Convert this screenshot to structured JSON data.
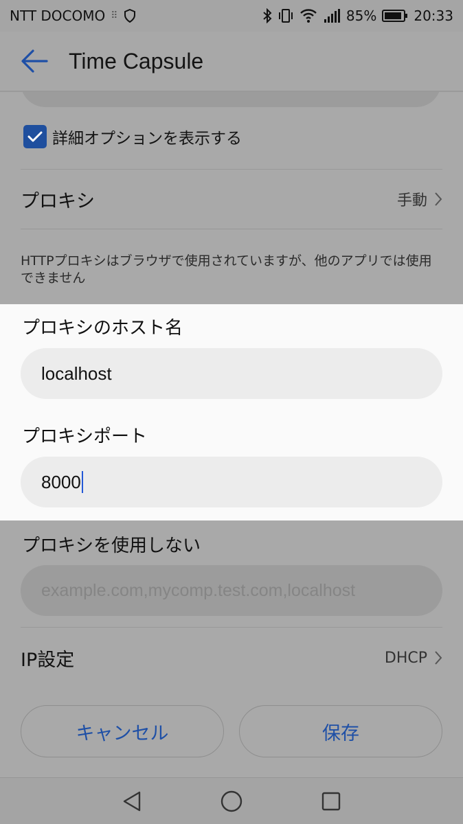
{
  "statusbar": {
    "carrier": "NTT DOCOMO",
    "battery": "85%",
    "time": "20:33"
  },
  "appbar": {
    "title": "Time Capsule"
  },
  "form": {
    "advanced_options_label": "詳細オプションを表示する",
    "advanced_options_checked": true,
    "proxy_label": "プロキシ",
    "proxy_value": "手動",
    "proxy_note": "HTTPプロキシはブラウザで使用されていますが、他のアプリでは使用できません",
    "proxy_host_label": "プロキシのホスト名",
    "proxy_host_value": "localhost",
    "proxy_port_label": "プロキシポート",
    "proxy_port_value": "8000",
    "bypass_label": "プロキシを使用しない",
    "bypass_placeholder": "example.com,mycomp.test.com,localhost",
    "ip_label": "IP設定",
    "ip_value": "DHCP"
  },
  "buttons": {
    "cancel": "キャンセル",
    "save": "保存"
  },
  "colors": {
    "accent": "#1e4fa6",
    "checkbox": "#1f4f9e"
  }
}
